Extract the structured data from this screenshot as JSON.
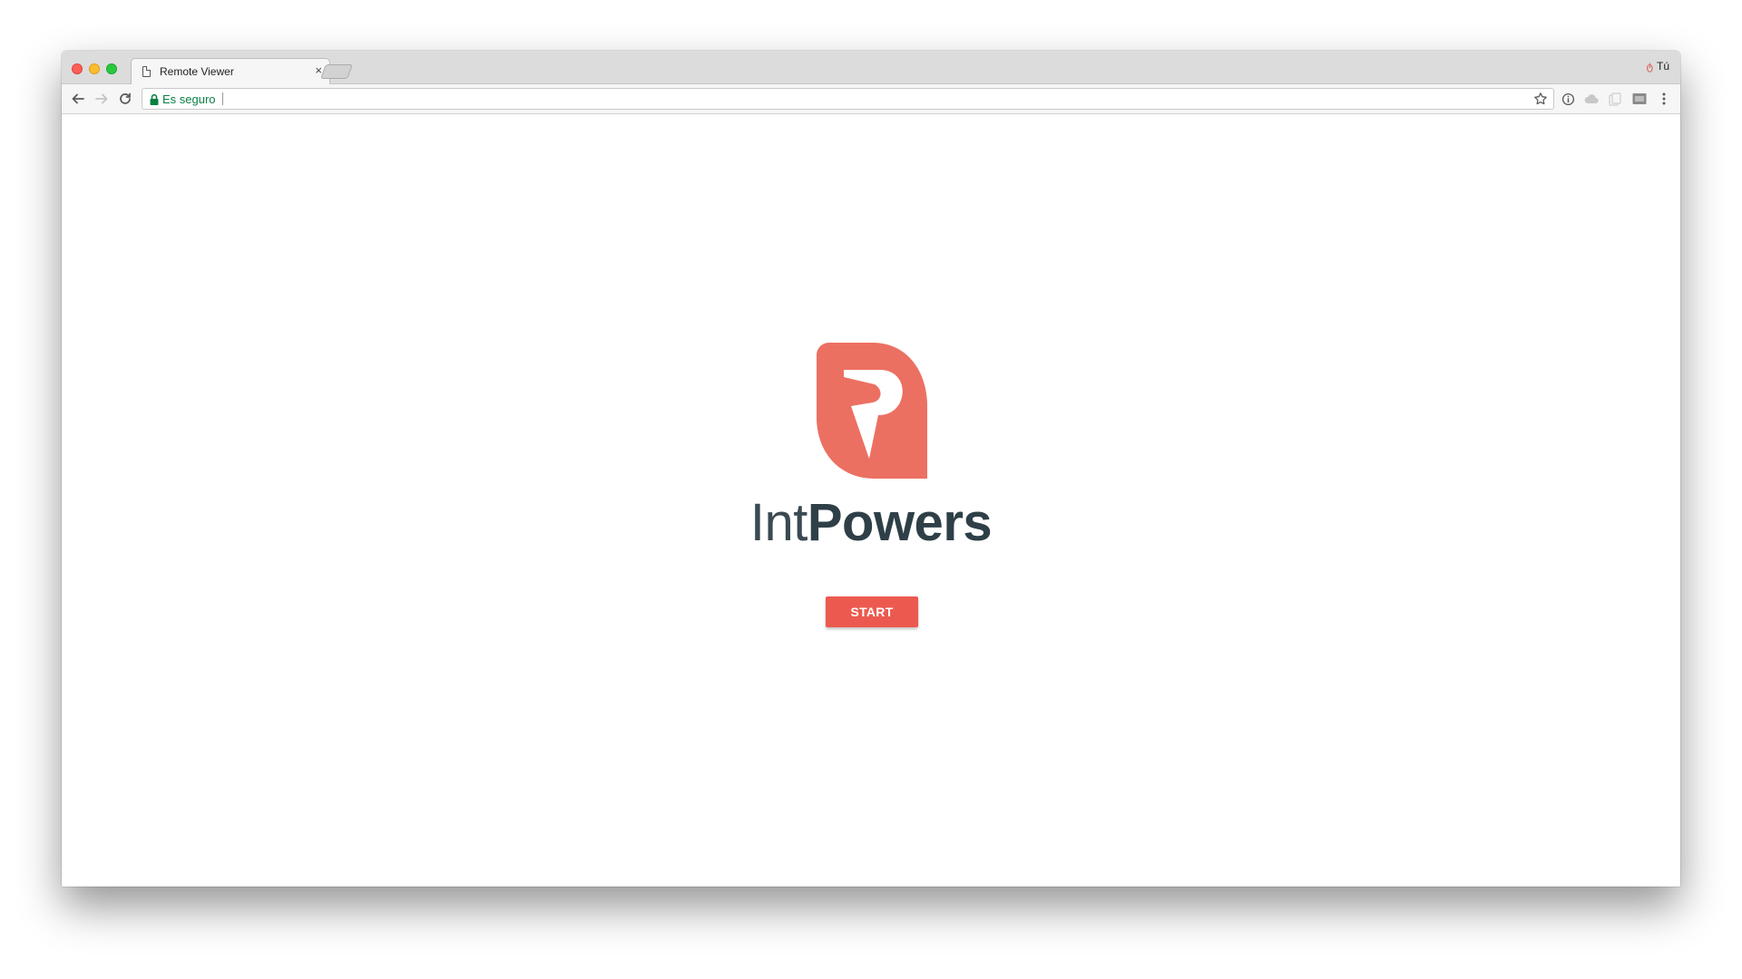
{
  "browser": {
    "tab": {
      "title": "Remote Viewer",
      "close_glyph": "×",
      "icon": "page-icon"
    },
    "profile": {
      "label": "Tú",
      "icon_glyph": "ტ"
    },
    "toolbar": {
      "back_icon": "arrow-left-icon",
      "forward_icon": "arrow-right-icon",
      "reload_icon": "reload-icon",
      "security_label": "Es seguro",
      "lock_icon": "lock-icon",
      "bookmark_icon": "star-icon",
      "extensions": [
        "info-icon",
        "cloud-icon",
        "copy-icon",
        "cast-icon"
      ],
      "menu_icon": "more-vert-icon"
    }
  },
  "page": {
    "logo": {
      "mark_icon": "intpowers-logo-mark",
      "brand_color": "#ec7062"
    },
    "wordmark": {
      "light": "Int",
      "bold": "Powers"
    },
    "start_button": {
      "label": "START",
      "color": "#ec5a4f"
    }
  }
}
